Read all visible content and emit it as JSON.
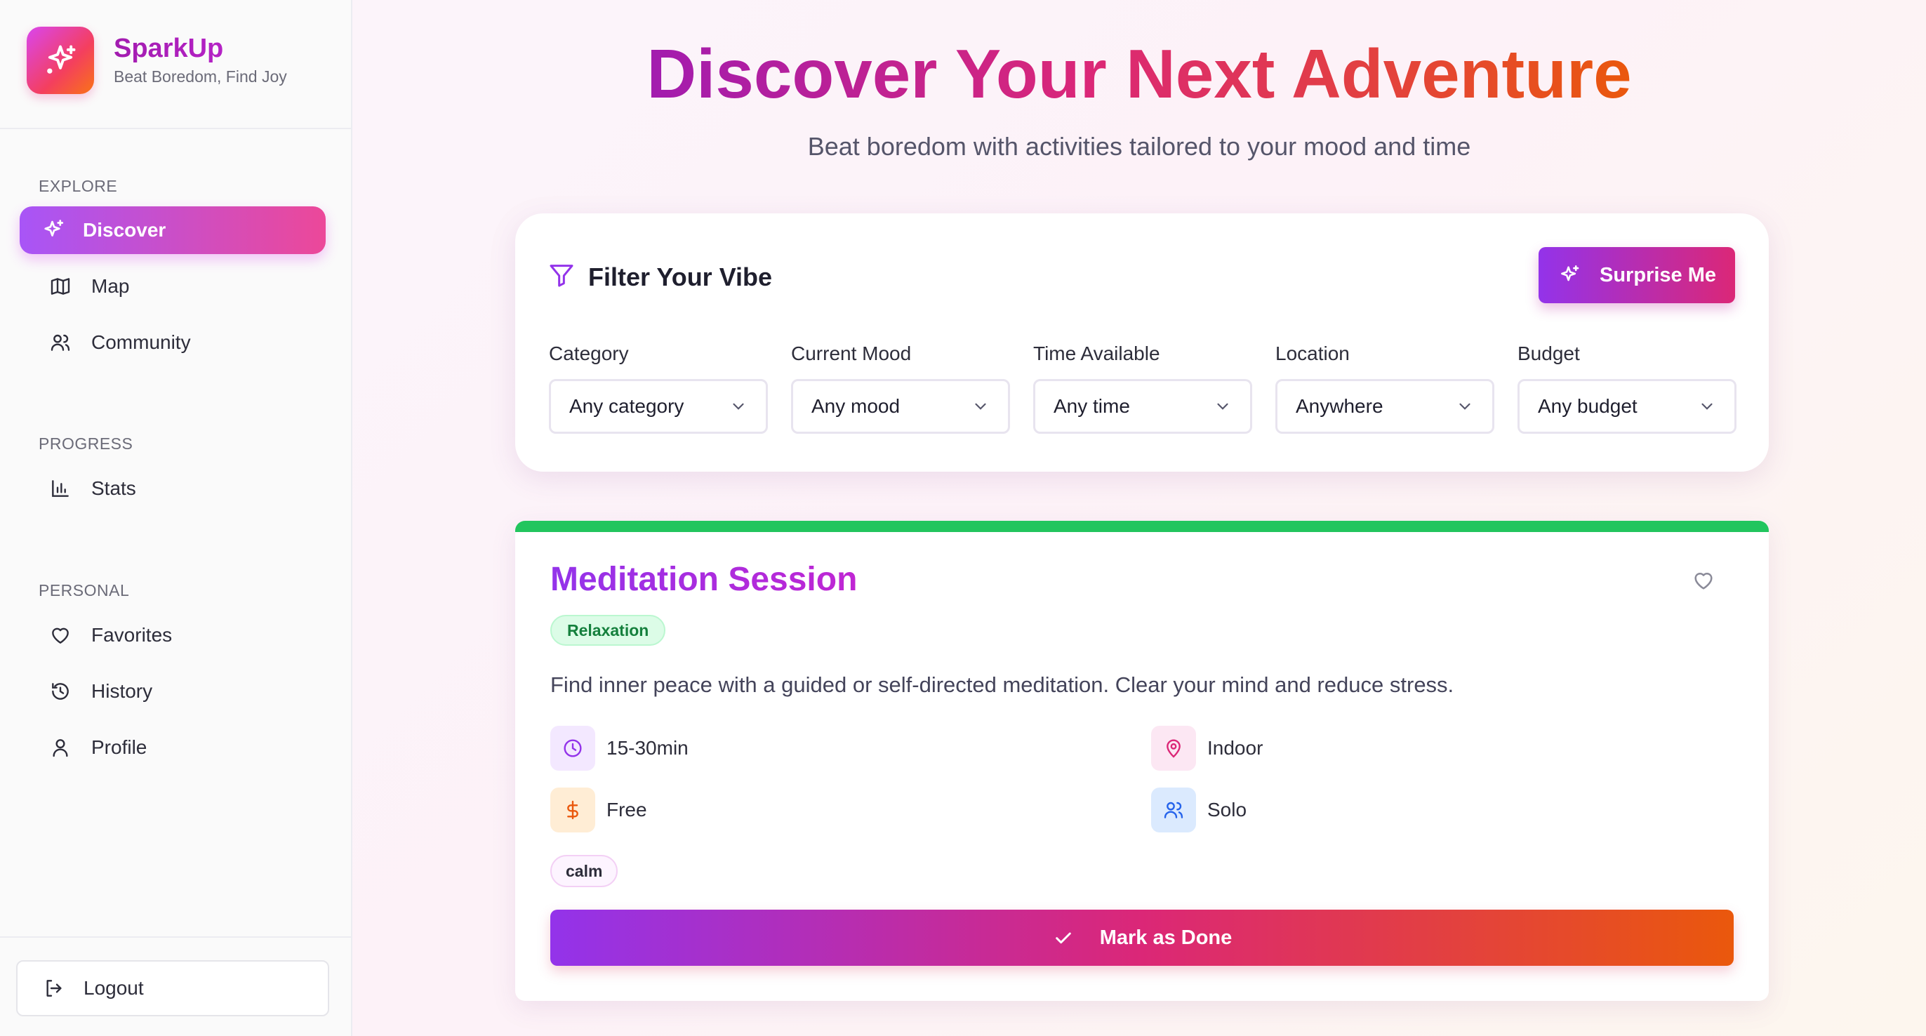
{
  "brand": {
    "name": "SparkUp",
    "tagline": "Beat Boredom, Find Joy"
  },
  "sidebar": {
    "sections": [
      {
        "label": "EXPLORE"
      },
      {
        "label": "PROGRESS"
      },
      {
        "label": "PERSONAL"
      }
    ],
    "items": [
      {
        "label": "Discover",
        "icon": "sparkles-icon",
        "active": true
      },
      {
        "label": "Map",
        "icon": "map-icon"
      },
      {
        "label": "Community",
        "icon": "users-icon"
      },
      {
        "label": "Stats",
        "icon": "bar-chart-icon"
      },
      {
        "label": "Favorites",
        "icon": "heart-icon"
      },
      {
        "label": "History",
        "icon": "history-icon"
      },
      {
        "label": "Profile",
        "icon": "user-icon"
      }
    ],
    "logout_label": "Logout"
  },
  "hero": {
    "title": "Discover Your Next Adventure",
    "subtitle": "Beat boredom with activities tailored to your mood and time"
  },
  "filters": {
    "title": "Filter Your Vibe",
    "surprise_label": "Surprise Me",
    "groups": [
      {
        "label": "Category",
        "value": "Any category"
      },
      {
        "label": "Current Mood",
        "value": "Any mood"
      },
      {
        "label": "Time Available",
        "value": "Any time"
      },
      {
        "label": "Location",
        "value": "Anywhere"
      },
      {
        "label": "Budget",
        "value": "Any budget"
      }
    ]
  },
  "activity": {
    "title": "Meditation Session",
    "category": "Relaxation",
    "description": "Find inner peace with a guided or self-directed meditation. Clear your mind and reduce stress.",
    "duration": "15-30min",
    "location": "Indoor",
    "cost": "Free",
    "group": "Solo",
    "tags": [
      "calm"
    ],
    "done_label": "Mark as Done",
    "accent_color": "#22c55e"
  },
  "colors": {
    "primary_purple": "#9333ea",
    "pink": "#db2777",
    "orange": "#ea580c"
  }
}
